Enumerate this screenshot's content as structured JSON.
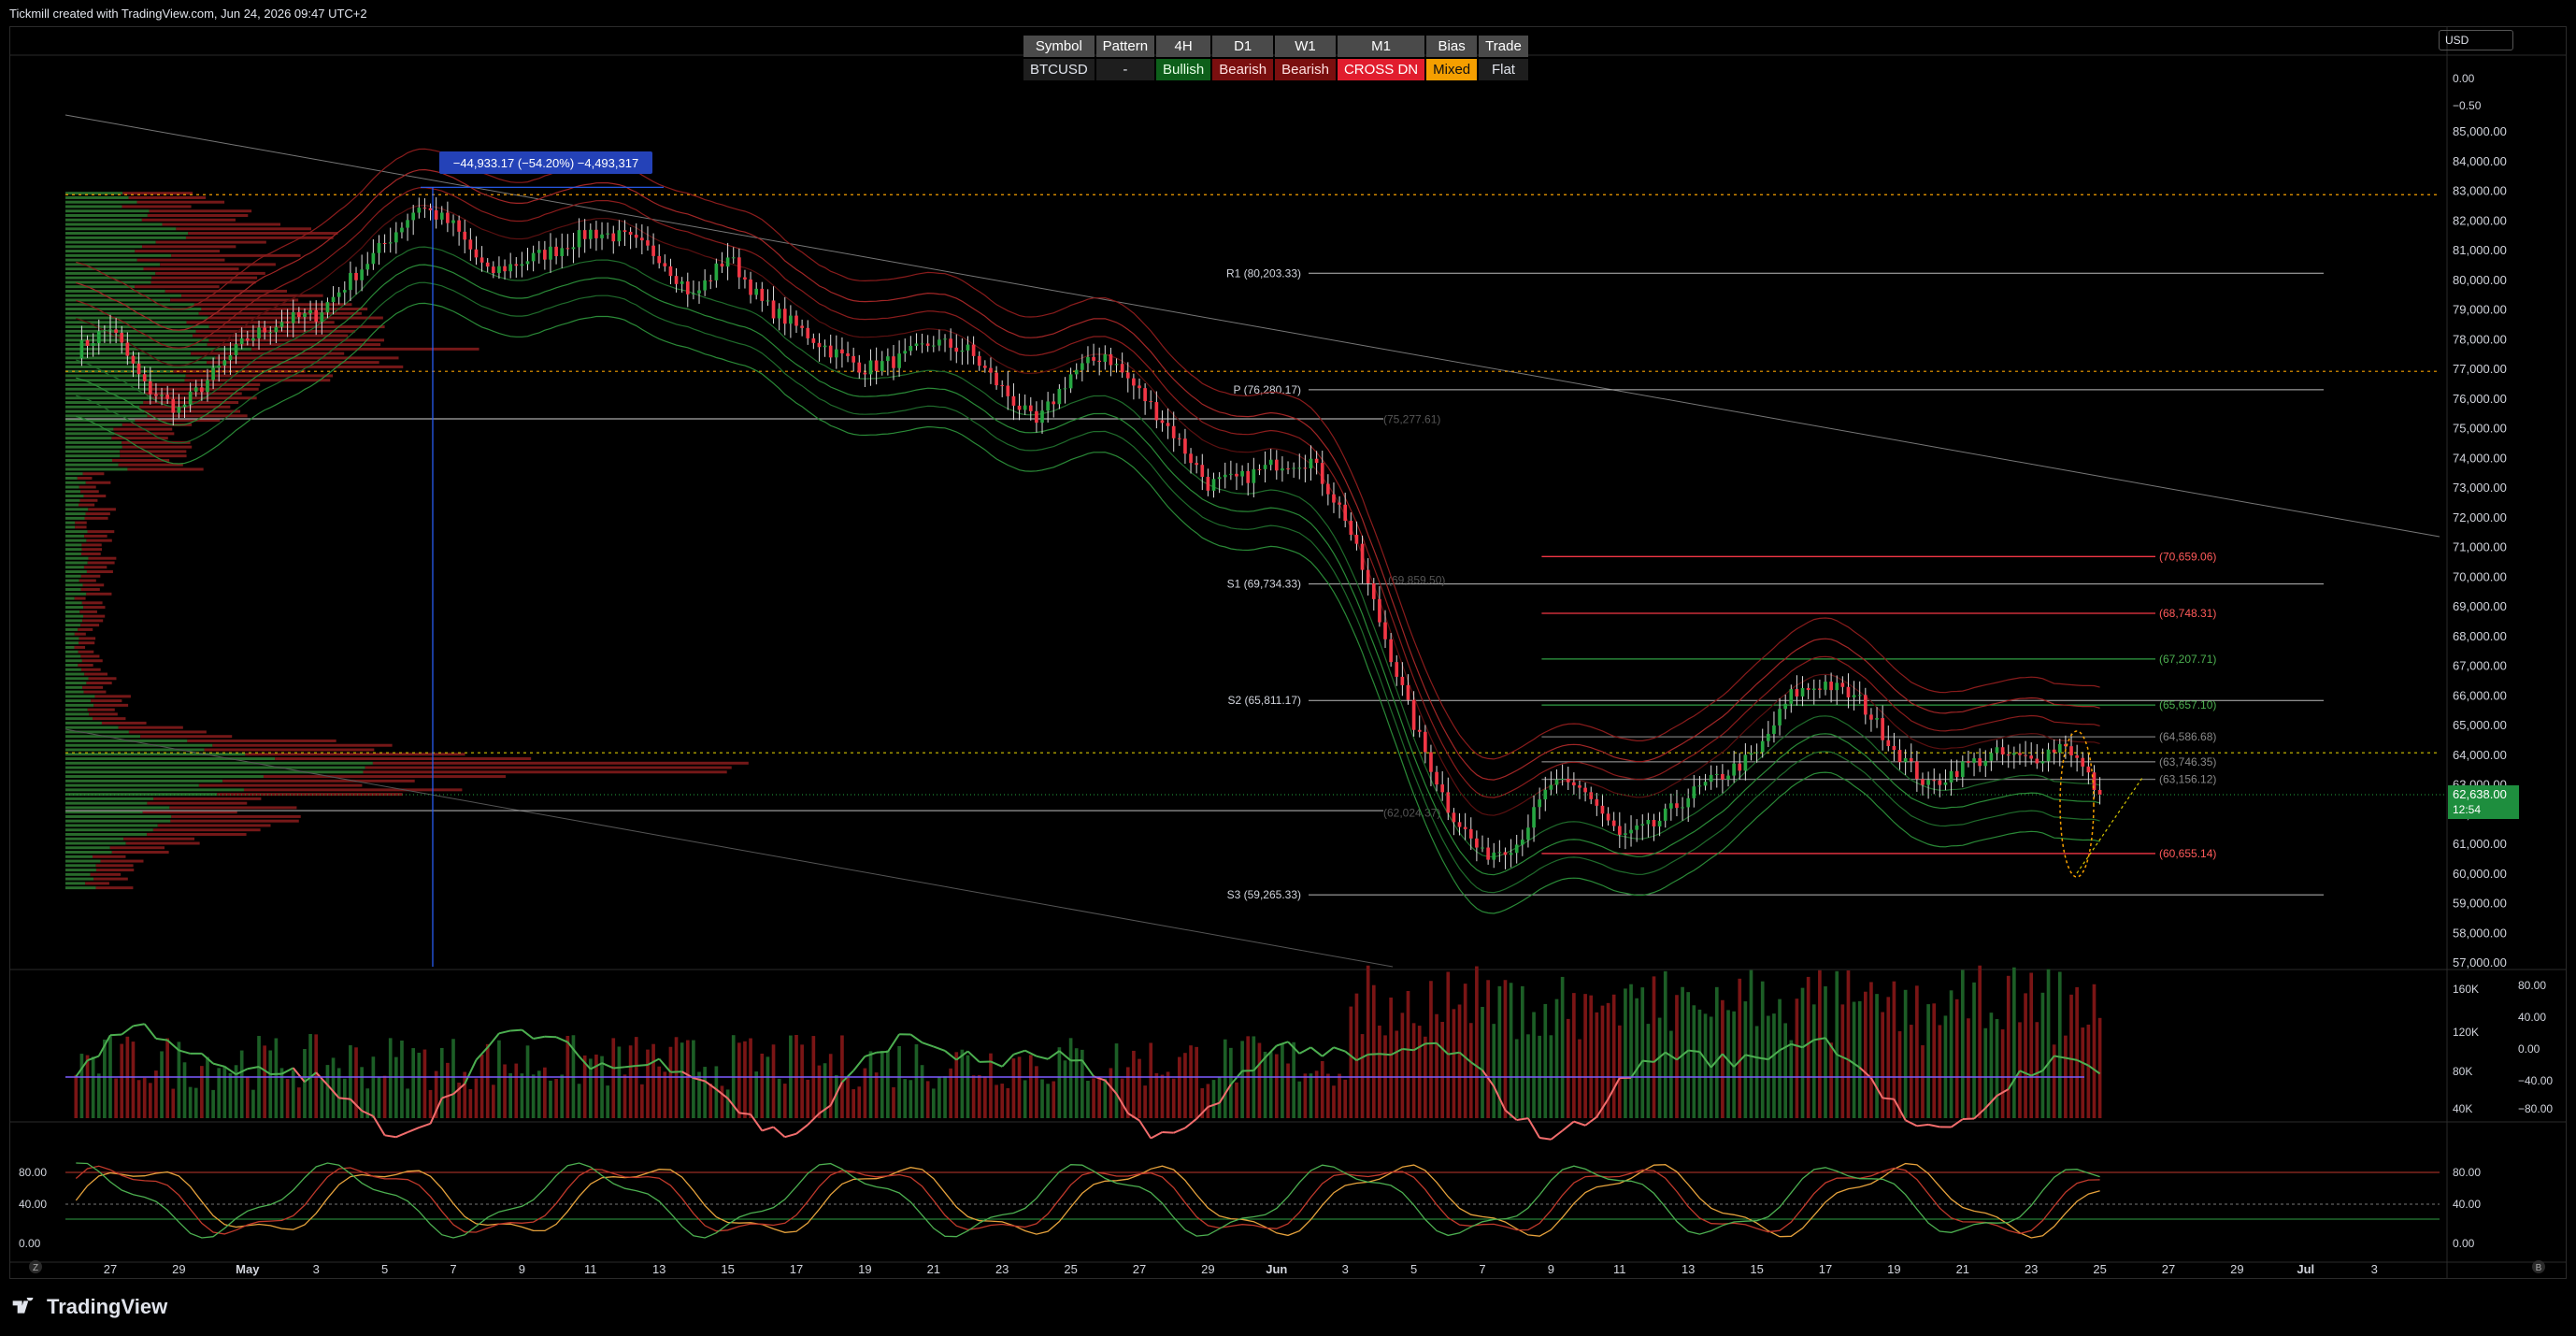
{
  "header": {
    "credit": "Tickmill created with TradingView.com, Jun 24, 2026 09:47 UTC+2",
    "currency": "USD",
    "brand": "TradingView"
  },
  "summary_table": {
    "headers": [
      "Symbol",
      "Pattern",
      "4H",
      "D1",
      "W1",
      "M1",
      "Bias",
      "Trade"
    ],
    "values": [
      "BTCUSD",
      "-",
      "Bullish",
      "Bearish",
      "Bearish",
      "CROSS DN",
      "Mixed",
      "Flat"
    ],
    "value_styles": [
      "neutral",
      "neutral",
      "bull",
      "bear",
      "bear",
      "cross",
      "mixed",
      "neutral"
    ]
  },
  "colors": {
    "bull": "#26a641",
    "bear": "#f23645",
    "grid_line": "#555555",
    "support_red": "#f23645",
    "resistance_green": "#2f9e44",
    "dotted_orange": "#f59f00",
    "dotted_yellow": "#d4c400",
    "measure_blue": "#2962ff"
  },
  "chart_data": {
    "type": "line",
    "x_ticks": [
      "27",
      "29",
      "May",
      "3",
      "5",
      "7",
      "9",
      "11",
      "13",
      "15",
      "17",
      "19",
      "21",
      "23",
      "25",
      "27",
      "29",
      "Jun",
      "3",
      "5",
      "7",
      "9",
      "11",
      "13",
      "15",
      "17",
      "19",
      "21",
      "23",
      "25",
      "27",
      "29",
      "Jul",
      "3"
    ],
    "price_axis": {
      "ticks": [
        85000,
        84000,
        83000,
        82000,
        81000,
        80000,
        79000,
        78000,
        77000,
        76000,
        75000,
        74000,
        73000,
        72000,
        71000,
        70000,
        69000,
        68000,
        67000,
        66000,
        65000,
        64000,
        63000,
        62000,
        61000,
        60000,
        59000,
        58000,
        57000
      ],
      "labels": [
        "85,000.00",
        "84,000.00",
        "83,000.00",
        "82,000.00",
        "81,000.00",
        "80,000.00",
        "79,000.00",
        "78,000.00",
        "77,000.00",
        "76,000.00",
        "75,000.00",
        "74,000.00",
        "73,000.00",
        "72,000.00",
        "71,000.00",
        "70,000.00",
        "69,000.00",
        "68,000.00",
        "67,000.00",
        "66,000.00",
        "65,000.00",
        "64,000.00",
        "63,000.00",
        "62,000.00",
        "61,000.00",
        "60,000.00",
        "59,000.00",
        "58,000.00",
        "57,000.00"
      ],
      "ylim": [
        56800,
        85500
      ]
    },
    "top_scale_labels": [
      "0.00",
      "−0.50"
    ],
    "last_price": {
      "value": 62638,
      "label": "62,638.00",
      "countdown": "12:54"
    },
    "pivots": [
      {
        "name": "R1",
        "label": "R1 (80,203.33)",
        "value": 80203.33,
        "x_range": [
          "Jun 2",
          "Jun 26"
        ]
      },
      {
        "name": "P",
        "label": "P (76,280.17)",
        "value": 76280.17,
        "x_range": [
          "Jun 2",
          "Jun 26"
        ]
      },
      {
        "name": "S1",
        "label": "S1 (69,734.33)",
        "value": 69734.33,
        "x_range": [
          "Jun 2",
          "Jun 26"
        ]
      },
      {
        "name": "S2",
        "label": "S2 (65,811.17)",
        "value": 65811.17,
        "x_range": [
          "Jun 2",
          "Jun 26"
        ]
      },
      {
        "name": "S3",
        "label": "S3 (59,265.33)",
        "value": 59265.33,
        "x_range": [
          "Jun 2",
          "Jun 26"
        ]
      }
    ],
    "ghost_labels": [
      {
        "label": "(75,277.61)",
        "value": 75277.61
      },
      {
        "label": "(69,859.50)",
        "value": 69859.5
      },
      {
        "label": "(62,024.37)",
        "value": 62024.37
      }
    ],
    "levels": [
      {
        "label": "(70,659.06)",
        "value": 70659.06,
        "kind": "red",
        "from": "Jun 8"
      },
      {
        "label": "(68,748.31)",
        "value": 68748.31,
        "kind": "red",
        "from": "Jun 8"
      },
      {
        "label": "(67,207.71)",
        "value": 67207.71,
        "kind": "green",
        "from": "Jun 8"
      },
      {
        "label": "(65,657.10)",
        "value": 65657.1,
        "kind": "green",
        "from": "Jun 8"
      },
      {
        "label": "(64,586.68)",
        "value": 64586.68,
        "kind": "grey",
        "from": "Jun 8"
      },
      {
        "label": "(63,746.35)",
        "value": 63746.35,
        "kind": "grey",
        "from": "Jun 8"
      },
      {
        "label": "(63,156.12)",
        "value": 63156.12,
        "kind": "grey",
        "from": "Jun 8"
      },
      {
        "label": "(60,655.14)",
        "value": 60655.14,
        "kind": "red",
        "from": "Jun 8"
      }
    ],
    "horizontal_lines": [
      {
        "value": 82850,
        "style": "dotted-orange"
      },
      {
        "value": 76900,
        "style": "dotted-orange"
      },
      {
        "value": 64050,
        "style": "dotted-yellow"
      },
      {
        "value": 75300,
        "style": "solid-grey"
      },
      {
        "value": 62100,
        "style": "solid-grey"
      }
    ],
    "measure": {
      "label": "−44,933.17 (−54.20%) −4,493,317",
      "x": "May 6.4",
      "top_value": 83100
    },
    "close_series": {
      "x_start": "Apr 26",
      "x_end": "Jun 24",
      "points_per_day": 6,
      "anchors": [
        [
          "Apr 26",
          77600
        ],
        [
          "Apr 27",
          78400
        ],
        [
          "Apr 28",
          76400
        ],
        [
          "Apr 29",
          75600
        ],
        [
          "Apr 30",
          76800
        ],
        [
          "May 1",
          78000
        ],
        [
          "May 2",
          78600
        ],
        [
          "May 3",
          78800
        ],
        [
          "May 4",
          80000
        ],
        [
          "May 5",
          81200
        ],
        [
          "May 6",
          82500
        ],
        [
          "May 7",
          81800
        ],
        [
          "May 8",
          80200
        ],
        [
          "May 9",
          80600
        ],
        [
          "May 10",
          81000
        ],
        [
          "May 11",
          81600
        ],
        [
          "May 12",
          81400
        ],
        [
          "May 13",
          80800
        ],
        [
          "May 14",
          79400
        ],
        [
          "May 15",
          80800
        ],
        [
          "May 16",
          79200
        ],
        [
          "May 17",
          78400
        ],
        [
          "May 18",
          77600
        ],
        [
          "May 19",
          77000
        ],
        [
          "May 20",
          77300
        ],
        [
          "May 21",
          77900
        ],
        [
          "May 22",
          77600
        ],
        [
          "May 23",
          76300
        ],
        [
          "May 24",
          75100
        ],
        [
          "May 25",
          76800
        ],
        [
          "May 26",
          77500
        ],
        [
          "May 27",
          76200
        ],
        [
          "May 28",
          74800
        ],
        [
          "May 29",
          73100
        ],
        [
          "May 30",
          73300
        ],
        [
          "May 31",
          73800
        ],
        [
          "Jun 1",
          73900
        ],
        [
          "Jun 2",
          72000
        ],
        [
          "Jun 3",
          68500
        ],
        [
          "Jun 4",
          65000
        ],
        [
          "Jun 5",
          62200
        ],
        [
          "Jun 6",
          60600
        ],
        [
          "Jun 7",
          61000
        ],
        [
          "Jun 8",
          63000
        ],
        [
          "Jun 9",
          62800
        ],
        [
          "Jun 10",
          61200
        ],
        [
          "Jun 11",
          61600
        ],
        [
          "Jun 12",
          62600
        ],
        [
          "Jun 13",
          63300
        ],
        [
          "Jun 14",
          64000
        ],
        [
          "Jun 15",
          66000
        ],
        [
          "Jun 16",
          66400
        ],
        [
          "Jun 17",
          65800
        ],
        [
          "Jun 18",
          64200
        ],
        [
          "Jun 19",
          62900
        ],
        [
          "Jun 20",
          63600
        ],
        [
          "Jun 21",
          64000
        ],
        [
          "Jun 22",
          63800
        ],
        [
          "Jun 23",
          64400
        ],
        [
          "Jun 24",
          62638
        ]
      ]
    },
    "oscillator": {
      "axis_labels": [
        "80.00",
        "40.00",
        "0.00",
        "−40.00",
        "−80.00"
      ],
      "volume_labels": [
        "160K",
        "120K",
        "80K",
        "40K"
      ]
    },
    "stochastic": {
      "axis_labels": [
        "80.00",
        "40.00",
        "0.00"
      ],
      "right_labels": [
        "80.00",
        "40.00",
        "0.00"
      ]
    },
    "axis_buttons": [
      "Z",
      "A",
      "B"
    ]
  }
}
